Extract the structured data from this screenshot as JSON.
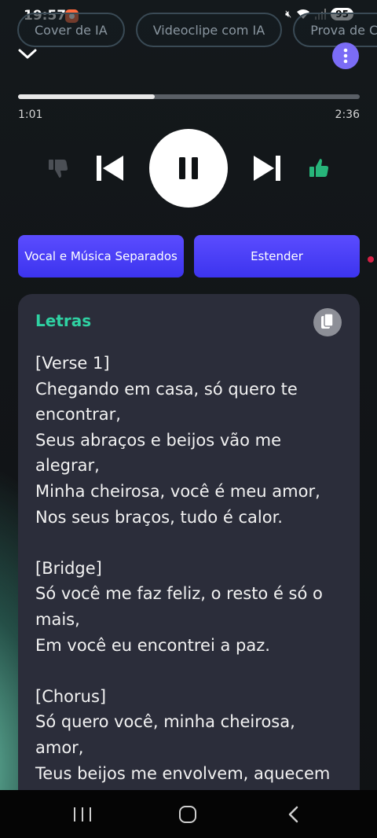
{
  "status_bar": {
    "time": "19:57",
    "battery": "95",
    "app_icon": "record-icon"
  },
  "chips": [
    "Cover de IA",
    "Videoclipe com IA",
    "Prova de C"
  ],
  "player": {
    "elapsed": "1:01",
    "total": "2:36",
    "progress_fraction": 0.4,
    "accent_color": "#7b6cf6",
    "like_color": "#27b57a"
  },
  "actions": {
    "separate_label": "Vocal e Música Separados",
    "extend_label": "Estender"
  },
  "lyrics": {
    "title": "Letras",
    "lines": [
      "[Verse 1]",
      "Chegando em casa, só quero te",
      "encontrar,",
      "Seus abraços e beijos vão me",
      "alegrar,",
      "Minha cheirosa, você é meu amor,",
      "Nos seus braços, tudo é calor.",
      "",
      "[Bridge]",
      "Só você me faz feliz, o resto é só o",
      "mais,",
      "Em você eu encontrei a paz.",
      "",
      "[Chorus]",
      "Só quero você, minha cheirosa,",
      "amor,",
      "Teus beijos me envolvem, aquecem"
    ]
  }
}
